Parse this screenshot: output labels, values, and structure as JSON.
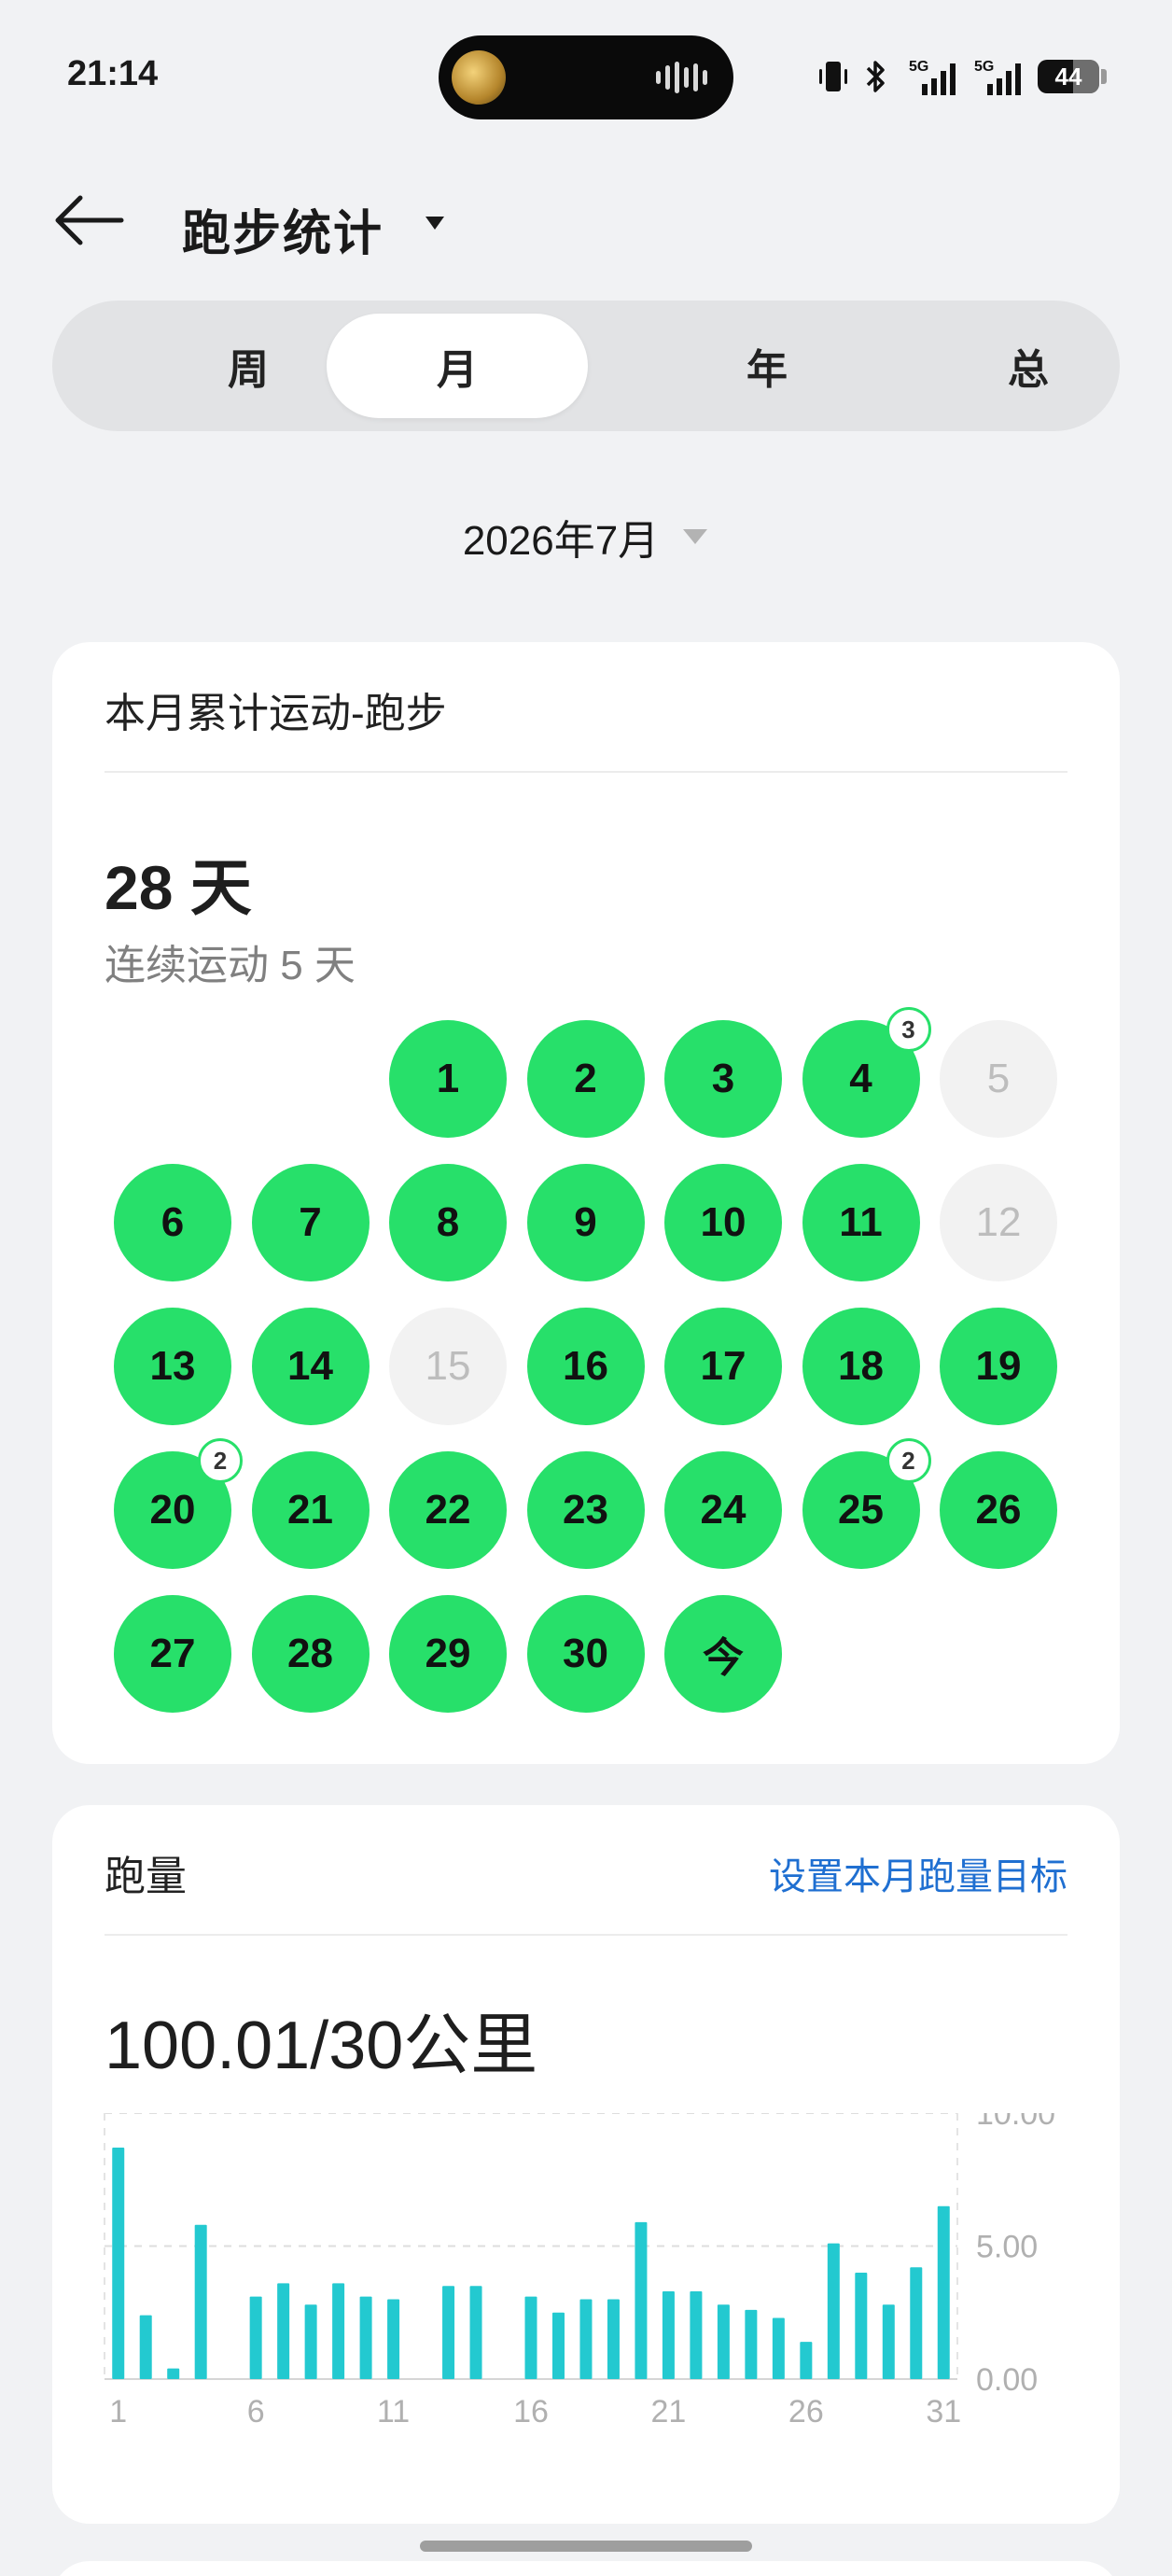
{
  "status_bar": {
    "time": "21:14",
    "icons": [
      "vibrate-icon",
      "bluetooth-icon",
      "signal-5g-icon",
      "signal-5g-icon"
    ],
    "battery": "44"
  },
  "header": {
    "title": "跑步统计"
  },
  "tabs": [
    {
      "label": "周",
      "active": false
    },
    {
      "label": "月",
      "active": true
    },
    {
      "label": "年",
      "active": false
    },
    {
      "label": "总",
      "active": false
    }
  ],
  "date_selector": {
    "label": "2026年7月"
  },
  "calendar_card": {
    "title": "本月累计运动-跑步",
    "total_days": "28 天",
    "streak": "连续运动 5 天",
    "days": [
      {
        "label": "1",
        "done": true
      },
      {
        "label": "2",
        "done": true
      },
      {
        "label": "3",
        "done": true
      },
      {
        "label": "4",
        "done": true,
        "badge": "3"
      },
      {
        "label": "5",
        "done": false
      },
      {
        "label": "6",
        "done": true
      },
      {
        "label": "7",
        "done": true
      },
      {
        "label": "8",
        "done": true
      },
      {
        "label": "9",
        "done": true
      },
      {
        "label": "10",
        "done": true
      },
      {
        "label": "11",
        "done": true
      },
      {
        "label": "12",
        "done": false
      },
      {
        "label": "13",
        "done": true
      },
      {
        "label": "14",
        "done": true
      },
      {
        "label": "15",
        "done": false
      },
      {
        "label": "16",
        "done": true
      },
      {
        "label": "17",
        "done": true
      },
      {
        "label": "18",
        "done": true
      },
      {
        "label": "19",
        "done": true
      },
      {
        "label": "20",
        "done": true,
        "badge": "2"
      },
      {
        "label": "21",
        "done": true
      },
      {
        "label": "22",
        "done": true
      },
      {
        "label": "23",
        "done": true
      },
      {
        "label": "24",
        "done": true
      },
      {
        "label": "25",
        "done": true,
        "badge": "2"
      },
      {
        "label": "26",
        "done": true
      },
      {
        "label": "27",
        "done": true
      },
      {
        "label": "28",
        "done": true
      },
      {
        "label": "29",
        "done": true
      },
      {
        "label": "30",
        "done": true
      },
      {
        "label": "今",
        "done": true
      }
    ],
    "first_weekday_index": 2
  },
  "distance_card": {
    "title": "跑量",
    "goal_link": "设置本月跑量目标",
    "value": "100.01/30公里"
  },
  "colors": {
    "accent_green": "#27e06a",
    "bar": "#23c9d0",
    "link": "#1f6fd1"
  },
  "chart_data": {
    "type": "bar",
    "x": [
      1,
      2,
      3,
      4,
      5,
      6,
      7,
      8,
      9,
      10,
      11,
      12,
      13,
      14,
      15,
      16,
      17,
      18,
      19,
      20,
      21,
      22,
      23,
      24,
      25,
      26,
      27,
      28,
      29,
      30,
      31
    ],
    "values": [
      8.7,
      2.4,
      0.4,
      5.8,
      0,
      3.1,
      3.6,
      2.8,
      3.6,
      3.1,
      3.0,
      0,
      3.5,
      3.5,
      0,
      3.1,
      2.5,
      3.0,
      3.0,
      5.9,
      3.3,
      3.3,
      2.8,
      2.6,
      2.3,
      1.4,
      5.1,
      4.0,
      2.8,
      4.2,
      6.5
    ],
    "x_tick_labels": [
      "1",
      "6",
      "11",
      "16",
      "21",
      "26",
      "31"
    ],
    "y_tick_labels": [
      "10.00",
      "5.00",
      "0.00"
    ],
    "ylim": [
      0,
      10
    ],
    "grid": true,
    "title": "",
    "xlabel": "",
    "ylabel": ""
  }
}
